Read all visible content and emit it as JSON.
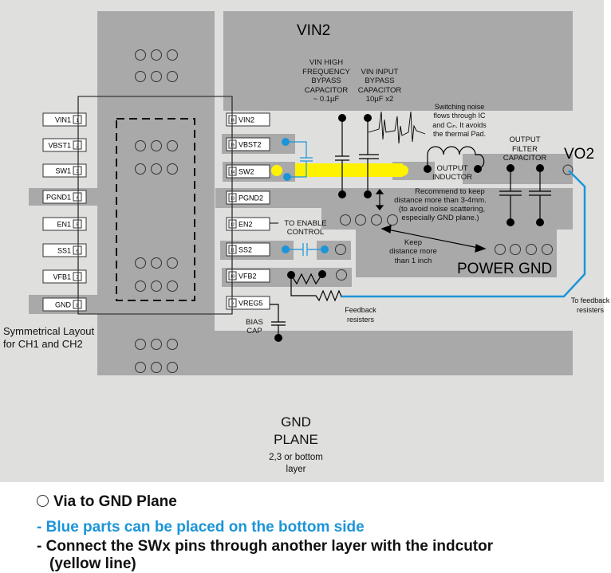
{
  "colors": {
    "background": "#dfdfde",
    "copper": "#a9a9a9",
    "pin_box": "#ffffff",
    "blue": "#1b95d8",
    "yellow": "#fff200",
    "black": "#000000"
  },
  "regions": {
    "vin2": "VIN2",
    "vo2": "VO2",
    "power_gnd": "POWER GND",
    "gnd_plane_line1": "GND",
    "gnd_plane_line2": "PLANE",
    "gnd_plane_sub1": "2,3 or bottom",
    "gnd_plane_sub2": "layer"
  },
  "left_pins": [
    {
      "name": "VIN1",
      "num": "1"
    },
    {
      "name": "VBST1",
      "num": "2"
    },
    {
      "name": "SW1",
      "num": "3"
    },
    {
      "name": "PGND1",
      "num": "4"
    },
    {
      "name": "EN1",
      "num": "5"
    },
    {
      "name": "SS1",
      "num": "6"
    },
    {
      "name": "VFB1",
      "num": "7"
    },
    {
      "name": "GND",
      "num": "8"
    }
  ],
  "right_pins": [
    {
      "name": "VIN2",
      "num": "16"
    },
    {
      "name": "VBST2",
      "num": "15"
    },
    {
      "name": "SW2",
      "num": "14"
    },
    {
      "name": "PGND2",
      "num": "13"
    },
    {
      "name": "EN2",
      "num": "12"
    },
    {
      "name": "SS2",
      "num": "11"
    },
    {
      "name": "VFB2",
      "num": "10"
    },
    {
      "name": "VREG5",
      "num": "9"
    }
  ],
  "annotations": {
    "symmetrical_1": "Symmetrical Layout",
    "symmetrical_2": "for CH1 and CH2",
    "hf_bypass": [
      "VIN HIGH",
      "FREQUENCY",
      "BYPASS",
      "CAPACITOR",
      "~ 0.1µF"
    ],
    "input_bypass": [
      "VIN INPUT",
      "BYPASS",
      "CAPACITOR",
      "10µF x2"
    ],
    "switching_noise": [
      "Switching noise",
      "flows through IC",
      "and Cᵢₙ. It avoids",
      "the thermal Pad."
    ],
    "output_filter": [
      "OUTPUT",
      "FILTER",
      "CAPACITOR"
    ],
    "output_inductor": [
      "OUTPUT",
      "INDUCTOR"
    ],
    "recommend": [
      "Recommend to keep",
      "distance more than 3-4mm.",
      "(to avoid noise scattering,",
      "especially GND plane.)"
    ],
    "to_enable": [
      "TO ENABLE",
      "CONTROL"
    ],
    "keep_distance": [
      "Keep",
      "distance more",
      "than 1 inch"
    ],
    "feedback_resisters": [
      "Feedback",
      "resisters"
    ],
    "to_feedback": [
      "To feedback",
      "resisters"
    ],
    "bias_cap": [
      "BIAS",
      "CAP"
    ]
  },
  "legend": {
    "via": "Via to GND Plane",
    "blue_note": "- Blue parts can be placed on the bottom side",
    "sw_note_1": "- Connect the SWx pins through another layer with the indcutor",
    "sw_note_2": "(yellow line)"
  }
}
